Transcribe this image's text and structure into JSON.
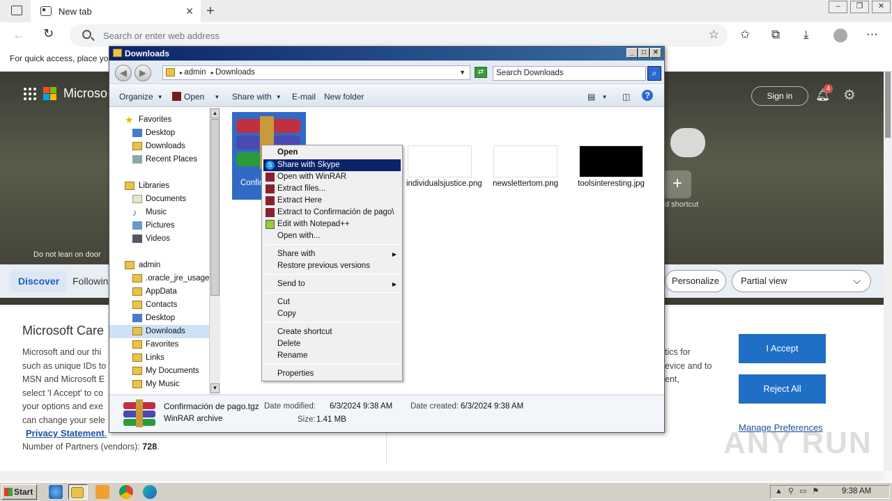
{
  "browser": {
    "tab_title": "New tab",
    "new_tab": "+",
    "address_placeholder": "Search or enter web address",
    "quick_access_text": "For quick access, place you",
    "window_controls": [
      "–",
      "❐",
      "✕"
    ]
  },
  "ntp": {
    "brand": "Microso",
    "sign_in": "Sign in",
    "notification_count": "4",
    "add_shortcut": "d shortcut",
    "do_not_lean": "Do not lean on door",
    "tabs": {
      "discover": "Discover",
      "following": "Followin"
    },
    "personalize": "Personalize",
    "partial_view": "Partial view"
  },
  "cookie": {
    "title": "Microsoft Care",
    "text_left": [
      "Microsoft and our thi",
      "such as unique IDs to",
      "MSN and Microsoft E",
      "select 'I Accept' to co",
      "your options and exe",
      "can change your sele"
    ],
    "privacy": "Privacy Statement",
    "privacy_suffix": ".",
    "partners_label": "Number of Partners (vendors): ",
    "partners_value": "728",
    "partners_suffix": ".",
    "text_right": [
      "tics for",
      "evice and to",
      "ent,"
    ],
    "accept": "I Accept",
    "reject": "Reject All",
    "manage": "Manage Preferences"
  },
  "explorer": {
    "title": "Downloads",
    "breadcrumb": [
      "admin",
      "Downloads"
    ],
    "search_placeholder": "Search Downloads",
    "commands": {
      "organize": "Organize",
      "open": "Open",
      "share_with": "Share with",
      "email": "E-mail",
      "new_folder": "New folder"
    },
    "nav": {
      "favorites": "Favorites",
      "fav_items": [
        "Desktop",
        "Downloads",
        "Recent Places"
      ],
      "libraries": "Libraries",
      "lib_items": [
        "Documents",
        "Music",
        "Pictures",
        "Videos"
      ],
      "admin": "admin",
      "admin_items": [
        ".oracle_jre_usage",
        "AppData",
        "Contacts",
        "Desktop",
        "Downloads",
        "Favorites",
        "Links",
        "My Documents",
        "My Music"
      ]
    },
    "files": [
      {
        "name": "Confir pa"
      },
      {
        "name": "individualsjustice.png"
      },
      {
        "name": "newslettertom.png"
      },
      {
        "name": "toolsinteresting.jpg"
      }
    ],
    "status": {
      "filename": "Confirmación de pago.tgz",
      "type": "WinRAR archive",
      "modified_label": "Date modified:",
      "modified": "6/3/2024 9:38 AM",
      "created_label": "Date created:",
      "created": "6/3/2024 9:38 AM",
      "size_label": "Size:",
      "size": "1.41 MB"
    }
  },
  "context_menu": {
    "items": [
      "Open",
      "Share with Skype",
      "Open with WinRAR",
      "Extract files...",
      "Extract Here",
      "Extract to Confirmación de pago\\",
      "Edit with Notepad++",
      "Open with...",
      "Share with",
      "Restore previous versions",
      "Send to",
      "Cut",
      "Copy",
      "Create shortcut",
      "Delete",
      "Rename",
      "Properties"
    ]
  },
  "taskbar": {
    "start": "Start",
    "clock": "9:38 AM"
  },
  "watermark": "ANY RUN"
}
